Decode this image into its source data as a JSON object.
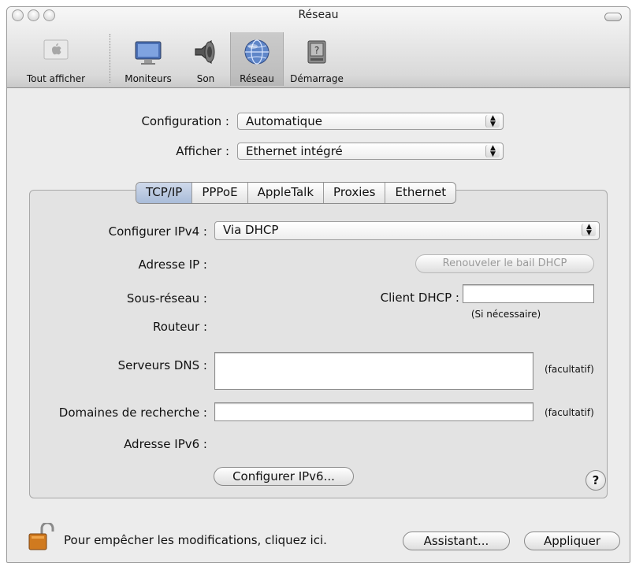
{
  "window": {
    "title": "Réseau"
  },
  "toolbar": {
    "items": [
      {
        "label": "Tout afficher",
        "icon": "apple-icon"
      },
      {
        "label": "Moniteurs",
        "icon": "monitor-icon"
      },
      {
        "label": "Son",
        "icon": "speaker-icon"
      },
      {
        "label": "Réseau",
        "icon": "network-globe-icon",
        "selected": true
      },
      {
        "label": "Démarrage",
        "icon": "startup-disk-icon"
      }
    ]
  },
  "config": {
    "configuration_label": "Configuration :",
    "configuration_value": "Automatique",
    "afficher_label": "Afficher :",
    "afficher_value": "Ethernet intégré"
  },
  "tabs": [
    "TCP/IP",
    "PPPoE",
    "AppleTalk",
    "Proxies",
    "Ethernet"
  ],
  "tcpip": {
    "configurer_ipv4_label": "Configurer IPv4 :",
    "configurer_ipv4_value": "Via DHCP",
    "adresse_ip_label": "Adresse IP :",
    "renew_button": "Renouveler le bail DHCP",
    "sous_reseau_label": "Sous-réseau :",
    "client_dhcp_label": "Client DHCP :",
    "client_dhcp_hint": "(Si nécessaire)",
    "routeur_label": "Routeur :",
    "dns_label": "Serveurs DNS :",
    "dns_optional": "(facultatif)",
    "domaines_label": "Domaines de recherche :",
    "domaines_optional": "(facultatif)",
    "ipv6_label": "Adresse IPv6 :",
    "configurer_ipv6_button": "Configurer IPv6..."
  },
  "footer": {
    "lock_text": "Pour empêcher les modifications, cliquez ici.",
    "assistant_button": "Assistant...",
    "appliquer_button": "Appliquer"
  },
  "colors": {
    "window_bg": "#ececec",
    "group_bg": "#e3e3e3",
    "accent_lock": "#d07a1f"
  }
}
